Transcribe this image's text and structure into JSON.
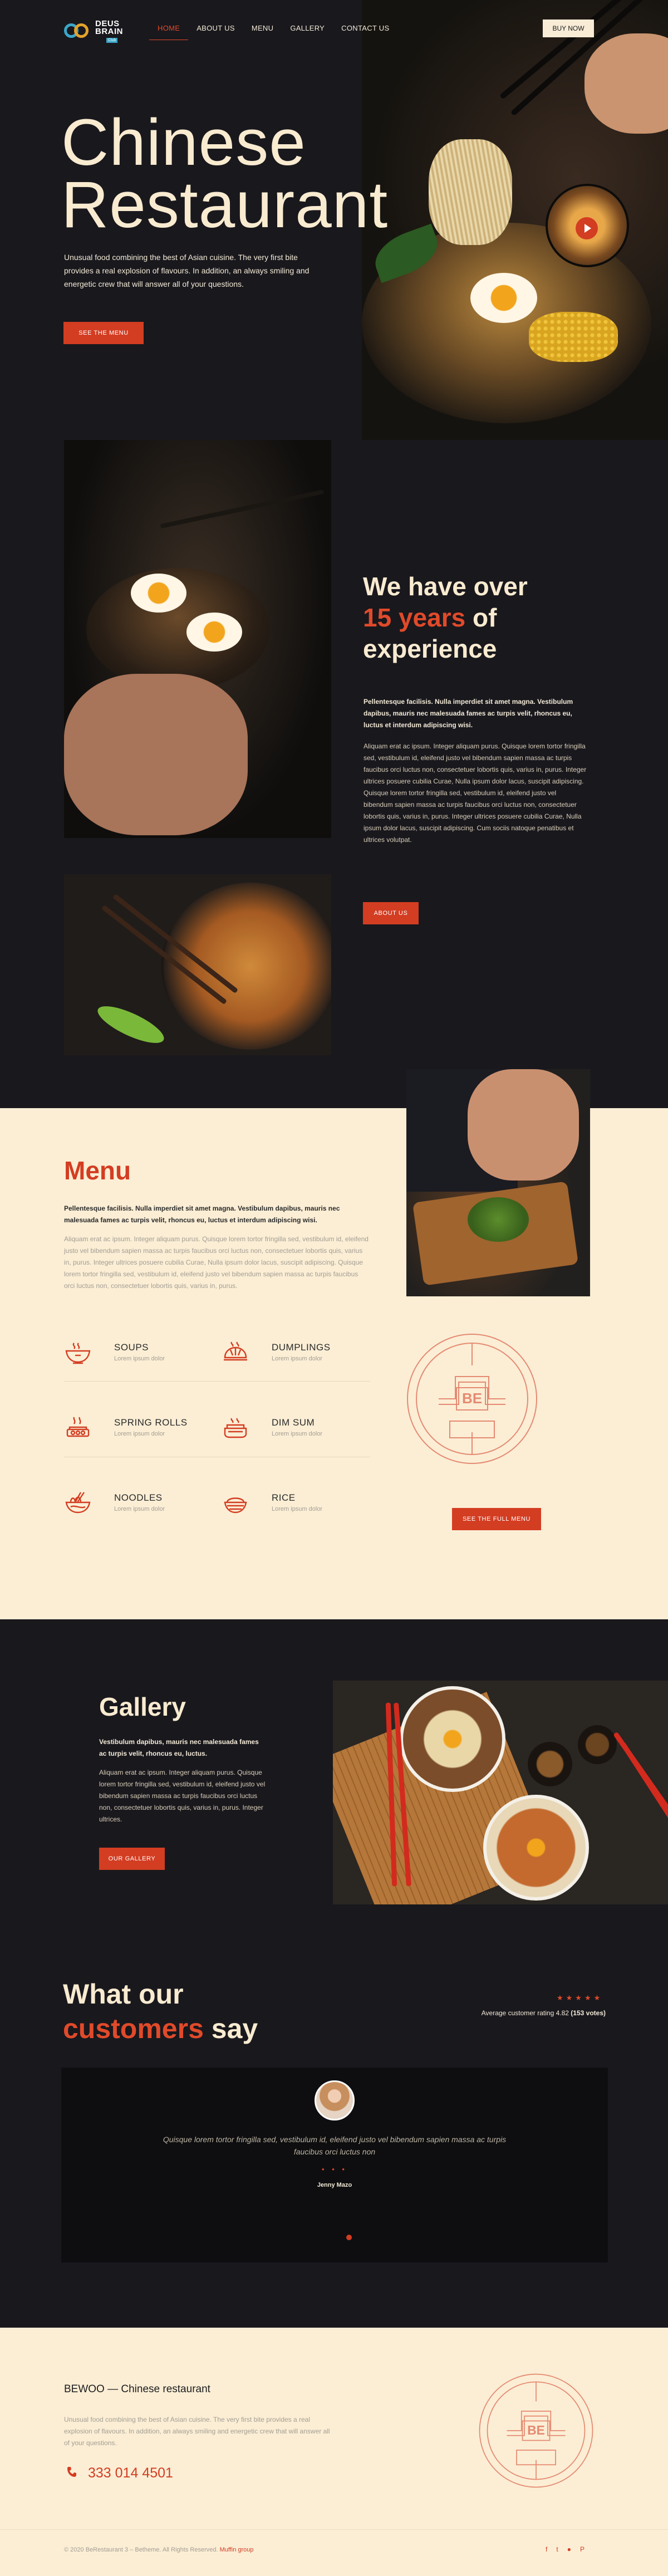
{
  "logo": {
    "word1": "DEUS",
    "word2": "BRAIN",
    "sub": "Club"
  },
  "nav": {
    "items": [
      {
        "label": "HOME"
      },
      {
        "label": "ABOUT US"
      },
      {
        "label": "MENU"
      },
      {
        "label": "GALLERY"
      },
      {
        "label": "CONTACT US"
      }
    ],
    "active_index": 0,
    "buy_label": "BUY NOW"
  },
  "hero": {
    "title_line1": "Chinese",
    "title_line2": "Restaurant",
    "description": "Unusual food combining the best of Asian cuisine. The very first bite provides a real explosion of flavours. In addition, an always smiling and energetic crew that will answer all of your questions.",
    "button": "SEE THE MENU"
  },
  "experience": {
    "title_pre": "We have over",
    "title_highlight": "15 years",
    "title_mid": " of",
    "title_post": "experience",
    "lead": "Pellentesque facilisis. Nulla imperdiet sit amet magna. Vestibulum dapibus, mauris nec malesuada fames ac turpis velit, rhoncus eu, luctus et interdum adipiscing wisi.",
    "body": "Aliquam erat ac ipsum. Integer aliquam purus. Quisque lorem tortor fringilla sed, vestibulum id, eleifend justo vel bibendum sapien massa ac turpis faucibus orci luctus non, consectetuer lobortis quis, varius in, purus. Integer ultrices posuere cubilia Curae, Nulla ipsum dolor lacus, suscipit adipiscing. Quisque lorem tortor fringilla sed, vestibulum id, eleifend justo vel bibendum sapien massa ac turpis faucibus orci luctus non, consectetuer lobortis quis, varius in, purus. Integer ultrices posuere cubilia Curae, Nulla ipsum dolor lacus, suscipit adipiscing. Cum sociis natoque penatibus et ultrices volutpat.",
    "button": "ABOUT US"
  },
  "menu": {
    "title": "Menu",
    "lead": "Pellentesque facilisis. Nulla imperdiet sit amet magna. Vestibulum dapibus, mauris nec malesuada fames ac turpis velit, rhoncus eu, luctus et interdum adipiscing wisi.",
    "body": "Aliquam erat ac ipsum. Integer aliquam purus. Quisque lorem tortor fringilla sed, vestibulum id, eleifend justo vel bibendum sapien massa ac turpis faucibus orci luctus non, consectetuer lobortis quis, varius in, purus. Integer ultrices posuere cubilia Curae, Nulla ipsum dolor lacus, suscipit adipiscing. Quisque lorem tortor fringilla sed, vestibulum id, eleifend justo vel bibendum sapien massa ac turpis faucibus orci luctus non, consectetuer lobortis quis, varius in, purus.",
    "dishes": [
      {
        "name": "SOUPS",
        "desc": "Lorem ipsum dolor",
        "icon": "soup-bowl-icon"
      },
      {
        "name": "DUMPLINGS",
        "desc": "Lorem ipsum dolor",
        "icon": "dumpling-icon"
      },
      {
        "name": "SPRING ROLLS",
        "desc": "Lorem ipsum dolor",
        "icon": "spring-roll-icon"
      },
      {
        "name": "DIM SUM",
        "desc": "Lorem ipsum dolor",
        "icon": "dim-sum-icon"
      },
      {
        "name": "NOODLES",
        "desc": "Lorem ipsum dolor",
        "icon": "noodles-icon"
      },
      {
        "name": "RICE",
        "desc": "Lorem ipsum dolor",
        "icon": "rice-bowl-icon"
      }
    ],
    "emblem_text": "BE",
    "button": "SEE THE FULL MENU"
  },
  "gallery": {
    "title": "Gallery",
    "lead": "Vestibulum dapibus, mauris nec malesuada fames ac turpis velit, rhoncus eu, luctus.",
    "body": "Aliquam erat ac ipsum. Integer aliquam purus. Quisque lorem tortor fringilla sed, vestibulum id, eleifend justo vel bibendum sapien massa ac turpis faucibus orci luctus non, consectetuer lobortis quis, varius in, purus. Integer ultrices.",
    "button": "OUR GALLERY"
  },
  "testimonials": {
    "title_pre": "What our",
    "title_highlight": "customers",
    "title_post": " say",
    "stars": "★★★★★",
    "rating_text": "Average customer rating 4.82 ",
    "rating_votes": "(153 votes)",
    "quote": "Quisque lorem tortor fringilla sed, vestibulum id, eleifend justo vel bibendum sapien massa ac turpis faucibus orci luctus non",
    "dots": "• • •",
    "name": "Jenny Mazo"
  },
  "footer": {
    "title": "BEWOO — Chinese restaurant",
    "description": "Unusual food combining the best of Asian cuisine. The very first bite provides a real explosion of flavours. In addition, an always smiling and energetic crew that will answer all of your questions.",
    "phone": "333 014 4501",
    "copyright": "© 2020 BeRestaurant 3 – Betheme. All Rights Reserved. ",
    "copyright_link": "Muffin group",
    "social": [
      "f",
      "t",
      "●",
      "P"
    ],
    "emblem_text": "BE"
  },
  "colors": {
    "accent": "#d33d22",
    "dark": "#19181d",
    "cream": "#fbeed5"
  }
}
